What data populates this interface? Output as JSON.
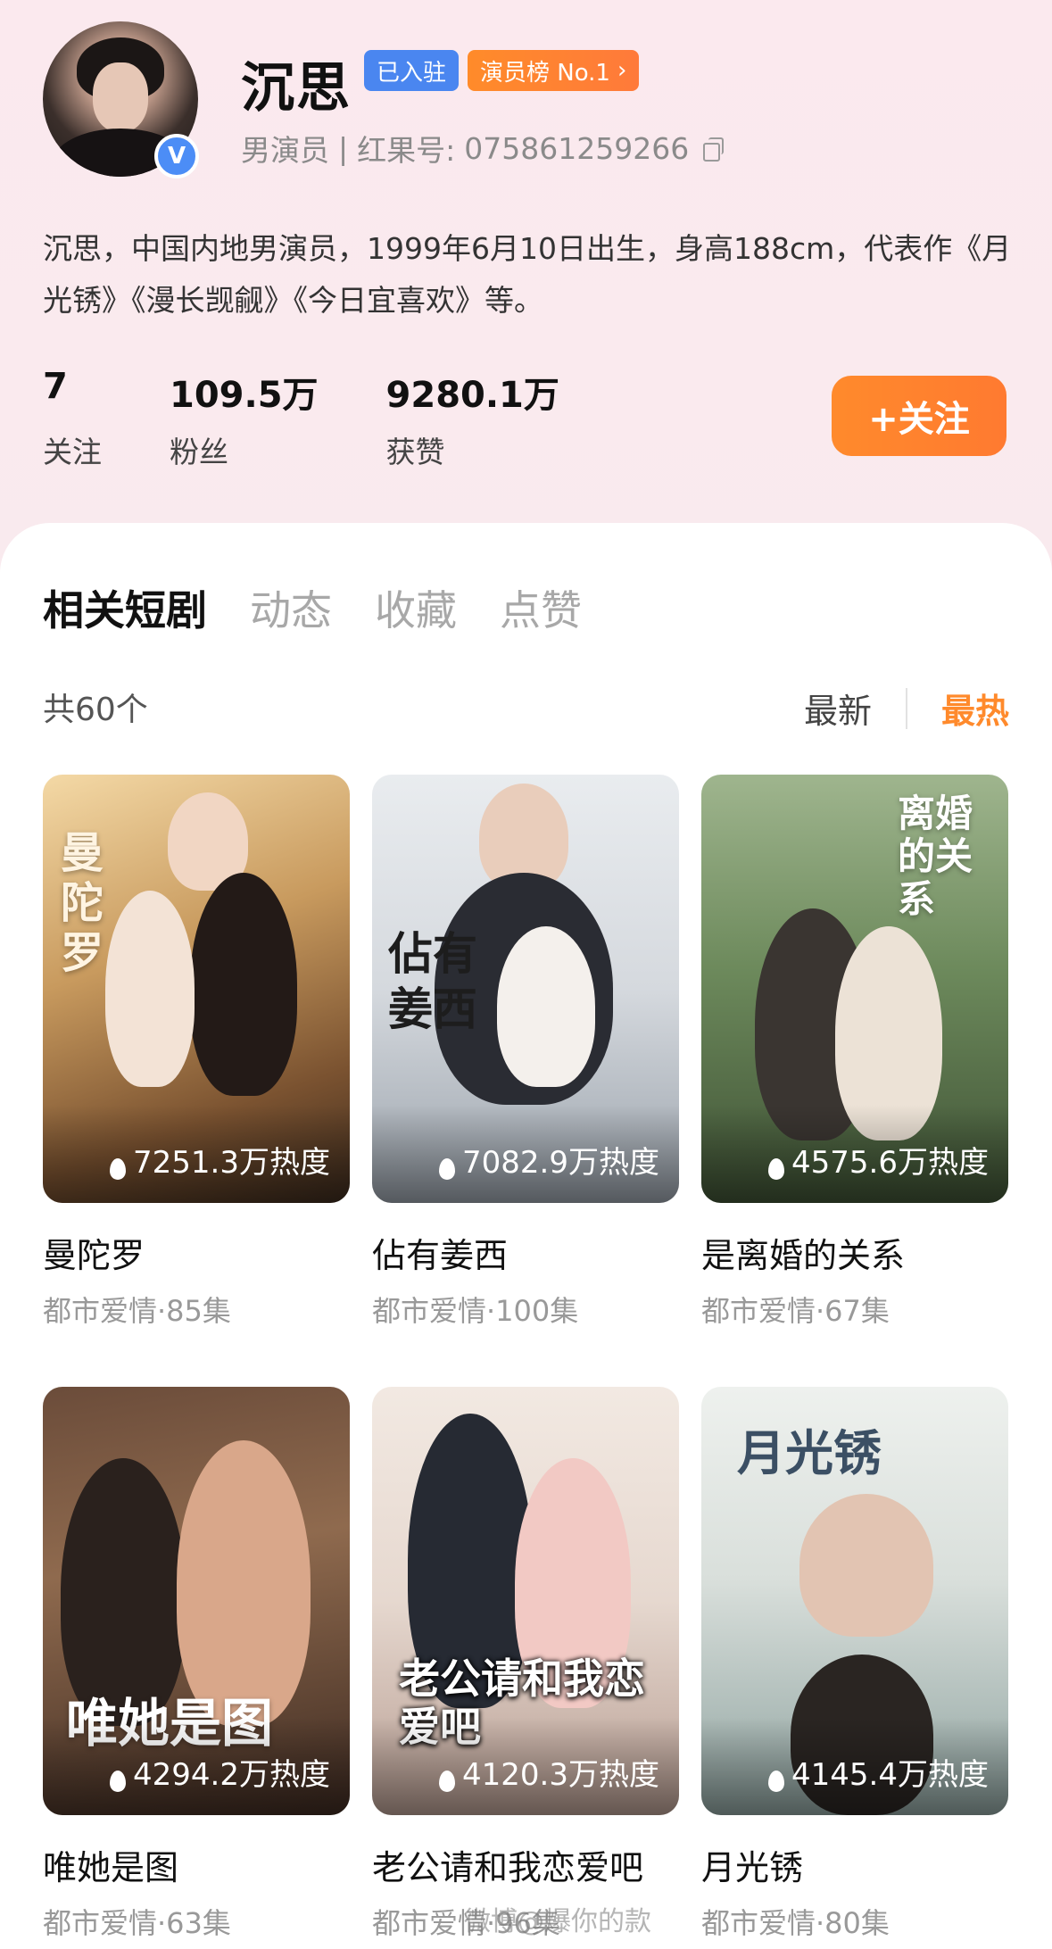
{
  "profile": {
    "name": "沉思",
    "tag_settled": "已入驻",
    "tag_rank": "演员榜 No.1",
    "role": "男演员",
    "separator": "|",
    "id_label": "红果号:",
    "id_value": "075861259266",
    "bio": "沉思，中国内地男演员，1999年6月10日出生，身高188cm，代表作《月光锈》《漫长觊觎》《今日宜喜欢》等。"
  },
  "stats": [
    {
      "value": "7",
      "label": "关注"
    },
    {
      "value": "109.5万",
      "label": "粉丝"
    },
    {
      "value": "9280.1万",
      "label": "获赞"
    }
  ],
  "follow_label": "+关注",
  "tabs": [
    "相关短剧",
    "动态",
    "收藏",
    "点赞"
  ],
  "list": {
    "count": "共60个",
    "sort_latest": "最新",
    "sort_hot": "最热"
  },
  "dramas": [
    {
      "title": "曼陀罗",
      "meta": "都市爱情·85集",
      "heat": "7251.3万热度",
      "poster_text": "曼陀罗"
    },
    {
      "title": "佔有姜西",
      "meta": "都市爱情·100集",
      "heat": "7082.9万热度",
      "poster_text": "佔有姜西"
    },
    {
      "title": "是离婚的关系",
      "meta": "都市爱情·67集",
      "heat": "4575.6万热度",
      "poster_text": "离婚的关系"
    },
    {
      "title": "唯她是图",
      "meta": "都市爱情·63集",
      "heat": "4294.2万热度",
      "poster_text": "唯她是图"
    },
    {
      "title": "老公请和我恋爱吧",
      "meta": "都市爱情·96集",
      "heat": "4120.3万热度",
      "poster_text": "老公请和我恋爱吧"
    },
    {
      "title": "月光锈",
      "meta": "都市爱情·80集",
      "heat": "4145.4万热度",
      "poster_text": "月光锈"
    }
  ],
  "watermark": "微博@爆你的款",
  "colors": {
    "accent": "#ff8a2c",
    "badge_blue": "#4a86f0"
  }
}
